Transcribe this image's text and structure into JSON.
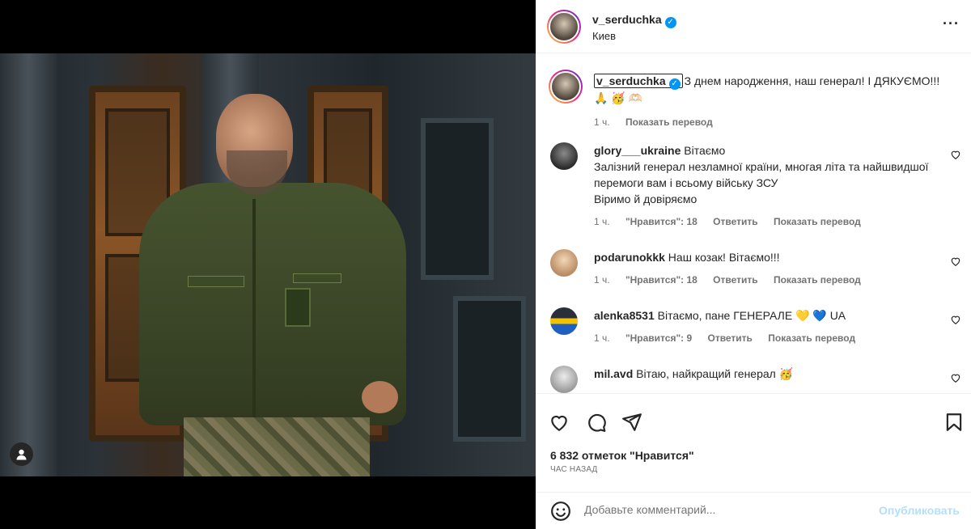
{
  "post": {
    "username": "v_serduchka",
    "location": "Киев",
    "caption": "З днем народження, наш генерал! І ДЯКУЄМО!!! 🙏 🥳 🫶🏻",
    "caption_time": "1 ч.",
    "caption_translate": "Показать перевод"
  },
  "comments": [
    {
      "username": "glory___ukraine",
      "text": "Вітаємо\nЗалізний генерал незламної країни, многая літа та найшвидшої перемоги вам і всьому війську ЗСУ\nВіримо й довіряємо",
      "time": "1 ч.",
      "likes": "\"Нравится\": 18",
      "reply": "Ответить",
      "translate": "Показать перевод"
    },
    {
      "username": "podarunokkk",
      "text": "Наш козак! Вітаємо!!!",
      "time": "1 ч.",
      "likes": "\"Нравится\": 18",
      "reply": "Ответить",
      "translate": "Показать перевод"
    },
    {
      "username": "alenka8531",
      "text": "Вітаємо, пане ГЕНЕРАЛЕ 💛 💙 UA",
      "time": "1 ч.",
      "likes": "\"Нравится\": 9",
      "reply": "Ответить",
      "translate": "Показать перевод"
    },
    {
      "username": "mil.avd",
      "text": "Вітаю, найкращий генерал 🥳",
      "time": "",
      "likes": "",
      "reply": "",
      "translate": ""
    }
  ],
  "actions": {
    "likes_count": "6 832 отметок \"Нравится\"",
    "time_ago": "ЧАС НАЗАД"
  },
  "comment_box": {
    "placeholder": "Добавьте комментарий...",
    "publish_label": "Опубликовать"
  },
  "colors": {
    "accent": "#0095f6",
    "publish_disabled": "#b2dffc",
    "muted": "#737373"
  },
  "icons": [
    "user-tag-icon",
    "verified-icon",
    "more-icon",
    "heart-icon",
    "comment-icon",
    "share-icon",
    "save-icon",
    "emoji-icon"
  ]
}
